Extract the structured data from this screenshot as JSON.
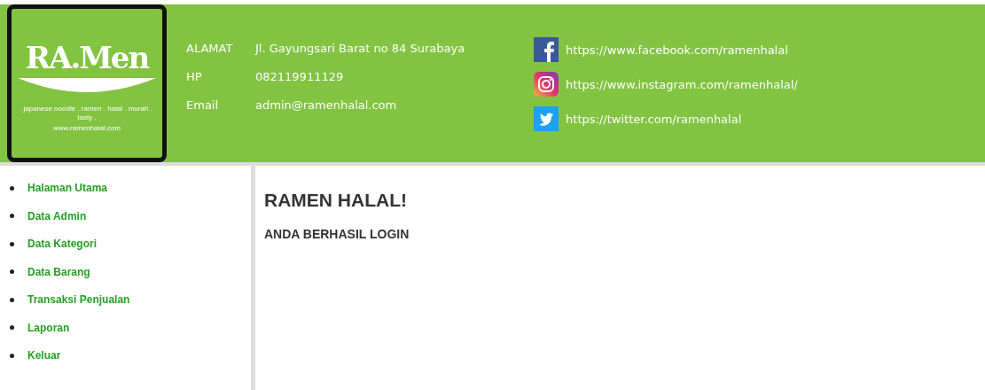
{
  "logo": {
    "title": "RA.Men",
    "tagline": ".japanese noodle . ramen . halal . murah . tasty .",
    "website": "www.ramenhalal.com"
  },
  "contact": [
    {
      "label": "ALAMAT",
      "value": "Jl. Gayungsari Barat no 84 Surabaya"
    },
    {
      "label": "HP",
      "value": "082119911129"
    },
    {
      "label": "Email",
      "value": "admin@ramenhalal.com"
    }
  ],
  "social": [
    {
      "kind": "facebook",
      "url": "https://www.facebook.com/ramenhalal"
    },
    {
      "kind": "instagram",
      "url": "https://www.instagram.com/ramenhalal/"
    },
    {
      "kind": "twitter",
      "url": "https://twitter.com/ramenhalal"
    }
  ],
  "sidebar": {
    "items": [
      "Halaman Utama",
      "Data Admin",
      "Data Kategori",
      "Data Barang",
      "Transaksi Penjualan",
      "Laporan",
      "Keluar"
    ]
  },
  "content": {
    "title": "RAMEN HALAL!",
    "message": "ANDA BERHASIL LOGIN"
  }
}
